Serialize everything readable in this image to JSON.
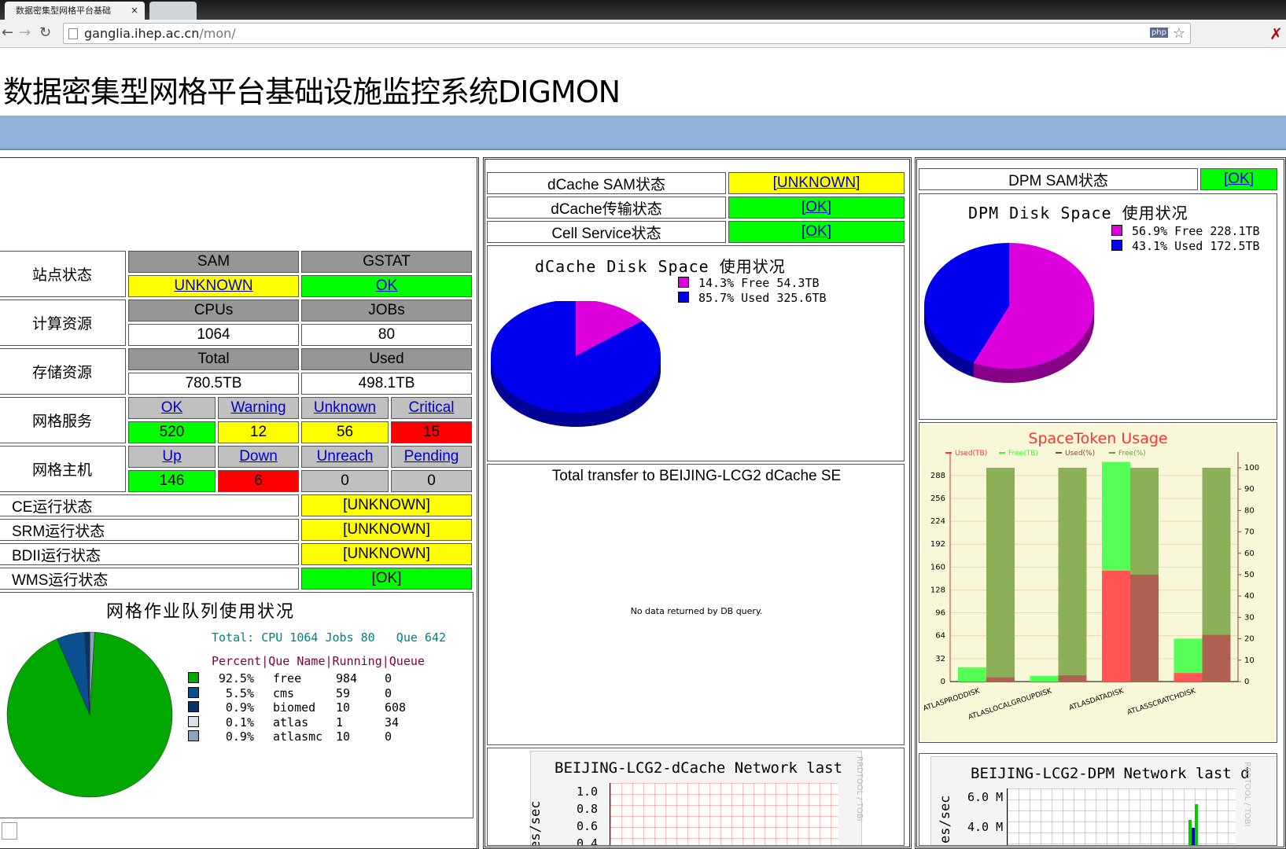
{
  "browser": {
    "tab_title": "数据密集型网格平台基础",
    "tab_close": "×",
    "url_host": "ganglia.ihep.ac.cn",
    "url_path": "/mon/",
    "ext_badge": "php"
  },
  "page_title": "数据密集型网格平台基础设施监控系统DIGMON",
  "site": {
    "rows": [
      {
        "label": "站点状态",
        "h1": "SAM",
        "h2": "GSTAT",
        "v1": "UNKNOWN",
        "v2": "OK"
      },
      {
        "label": "计算资源",
        "h1": "CPUs",
        "h2": "JOBs",
        "v1": "1064",
        "v2": "80"
      },
      {
        "label": "存储资源",
        "h1": "Total",
        "h2": "Used",
        "v1": "780.5TB",
        "v2": "498.1TB"
      }
    ],
    "services": {
      "label": "网格服务",
      "h": [
        "OK",
        "Warning",
        "Unknown",
        "Critical"
      ],
      "v": [
        "520",
        "12",
        "56",
        "15"
      ]
    },
    "hosts": {
      "label": "网格主机",
      "h": [
        "Up",
        "Down",
        "Unreach",
        "Pending"
      ],
      "v": [
        "146",
        "6",
        "0",
        "0"
      ]
    },
    "status": [
      {
        "label": "CE运行状态",
        "value": "[UNKNOWN]"
      },
      {
        "label": "SRM运行状态",
        "value": "[UNKNOWN]"
      },
      {
        "label": "BDII运行状态",
        "value": "[UNKNOWN]"
      },
      {
        "label": "WMS运行状态",
        "value": "[OK]"
      }
    ]
  },
  "queue_chart": {
    "title": "网格作业队列使用状况",
    "total_line": "Total: CPU 1064 Jobs 80   Que 642",
    "header": "Percent|Que Name|Running|Queue",
    "rows": [
      {
        "pct": "92.5%",
        "name": "free",
        "running": "984",
        "queue": "0",
        "color": "#00a800"
      },
      {
        "pct": "5.5%",
        "name": "cms",
        "running": "59",
        "queue": "0",
        "color": "#0a4f8f"
      },
      {
        "pct": "0.9%",
        "name": "biomed",
        "running": "10",
        "queue": "608",
        "color": "#0c3466"
      },
      {
        "pct": "0.1%",
        "name": "atlas",
        "running": "1",
        "queue": "34",
        "color": "#d8e2ec"
      },
      {
        "pct": "0.9%",
        "name": "atlasmc",
        "running": "10",
        "queue": "0",
        "color": "#8aa2bc"
      }
    ]
  },
  "dcache": {
    "rows": [
      {
        "label": "dCache SAM状态",
        "value": "[UNKNOWN]"
      },
      {
        "label": "dCache传输状态",
        "value": "[OK]"
      },
      {
        "label": "Cell Service状态",
        "value": "[OK]"
      }
    ],
    "disk_title": "dCache Disk Space 使用状况",
    "legend": [
      {
        "text": "14.3% Free 54.3TB",
        "color": "#dd00dd"
      },
      {
        "text": "85.7% Used 325.6TB",
        "color": "#0000ee"
      }
    ],
    "transfer_title": "Total transfer to BEIJING-LCG2 dCache SE",
    "no_data": "No data returned by DB query.",
    "net_title": "BEIJING-LCG2-dCache Network last",
    "net_ylabel": "es/sec",
    "net_ticks": [
      "1.0",
      "0.8",
      "0.6",
      "0.4"
    ],
    "rrd": "RRDTOOL / TOBI"
  },
  "dpm": {
    "label": "DPM SAM状态",
    "value": "[OK]",
    "disk_title": "DPM Disk Space 使用状况",
    "legend": [
      {
        "text": "56.9% Free 228.1TB",
        "color": "#dd00dd"
      },
      {
        "text": "43.1% Used 172.5TB",
        "color": "#0000ee"
      }
    ],
    "net_title": "BEIJING-LCG2-DPM Network last d",
    "net_ylabel": "es/sec",
    "net_ticks": [
      "6.0 M",
      "4.0 M"
    ],
    "rrd": "RRDTOOL / TOBI"
  },
  "chart_data": {
    "type": "bar",
    "title": "SpaceToken Usage",
    "legend": [
      "Used(TB)",
      "Free(TB)",
      "Used(%)",
      "Free(%)"
    ],
    "categories": [
      "ATLASPRODDISK",
      "ATLASLOCALGROUPDISK",
      "ATLASDATADISK",
      "ATLASSCRATCHDISK"
    ],
    "series": [
      {
        "name": "Used(TB)",
        "values": [
          0,
          0,
          155,
          12
        ],
        "color": "#ff5555"
      },
      {
        "name": "Free(TB)",
        "values": [
          20,
          8,
          152,
          48
        ],
        "color": "#55ff55"
      },
      {
        "name": "Used(%)",
        "values": [
          2,
          3,
          50,
          22
        ],
        "color": "#b06050"
      },
      {
        "name": "Free(%)",
        "values": [
          98,
          97,
          50,
          78
        ],
        "color": "#8cb058"
      }
    ],
    "yleft_ticks": [
      0,
      32,
      64,
      96,
      128,
      160,
      192,
      224,
      256,
      288
    ],
    "yright_ticks": [
      0,
      10,
      20,
      30,
      40,
      50,
      60,
      70,
      80,
      90,
      100
    ],
    "ylim_left": [
      0,
      312
    ],
    "ylim_right": [
      0,
      100
    ]
  }
}
